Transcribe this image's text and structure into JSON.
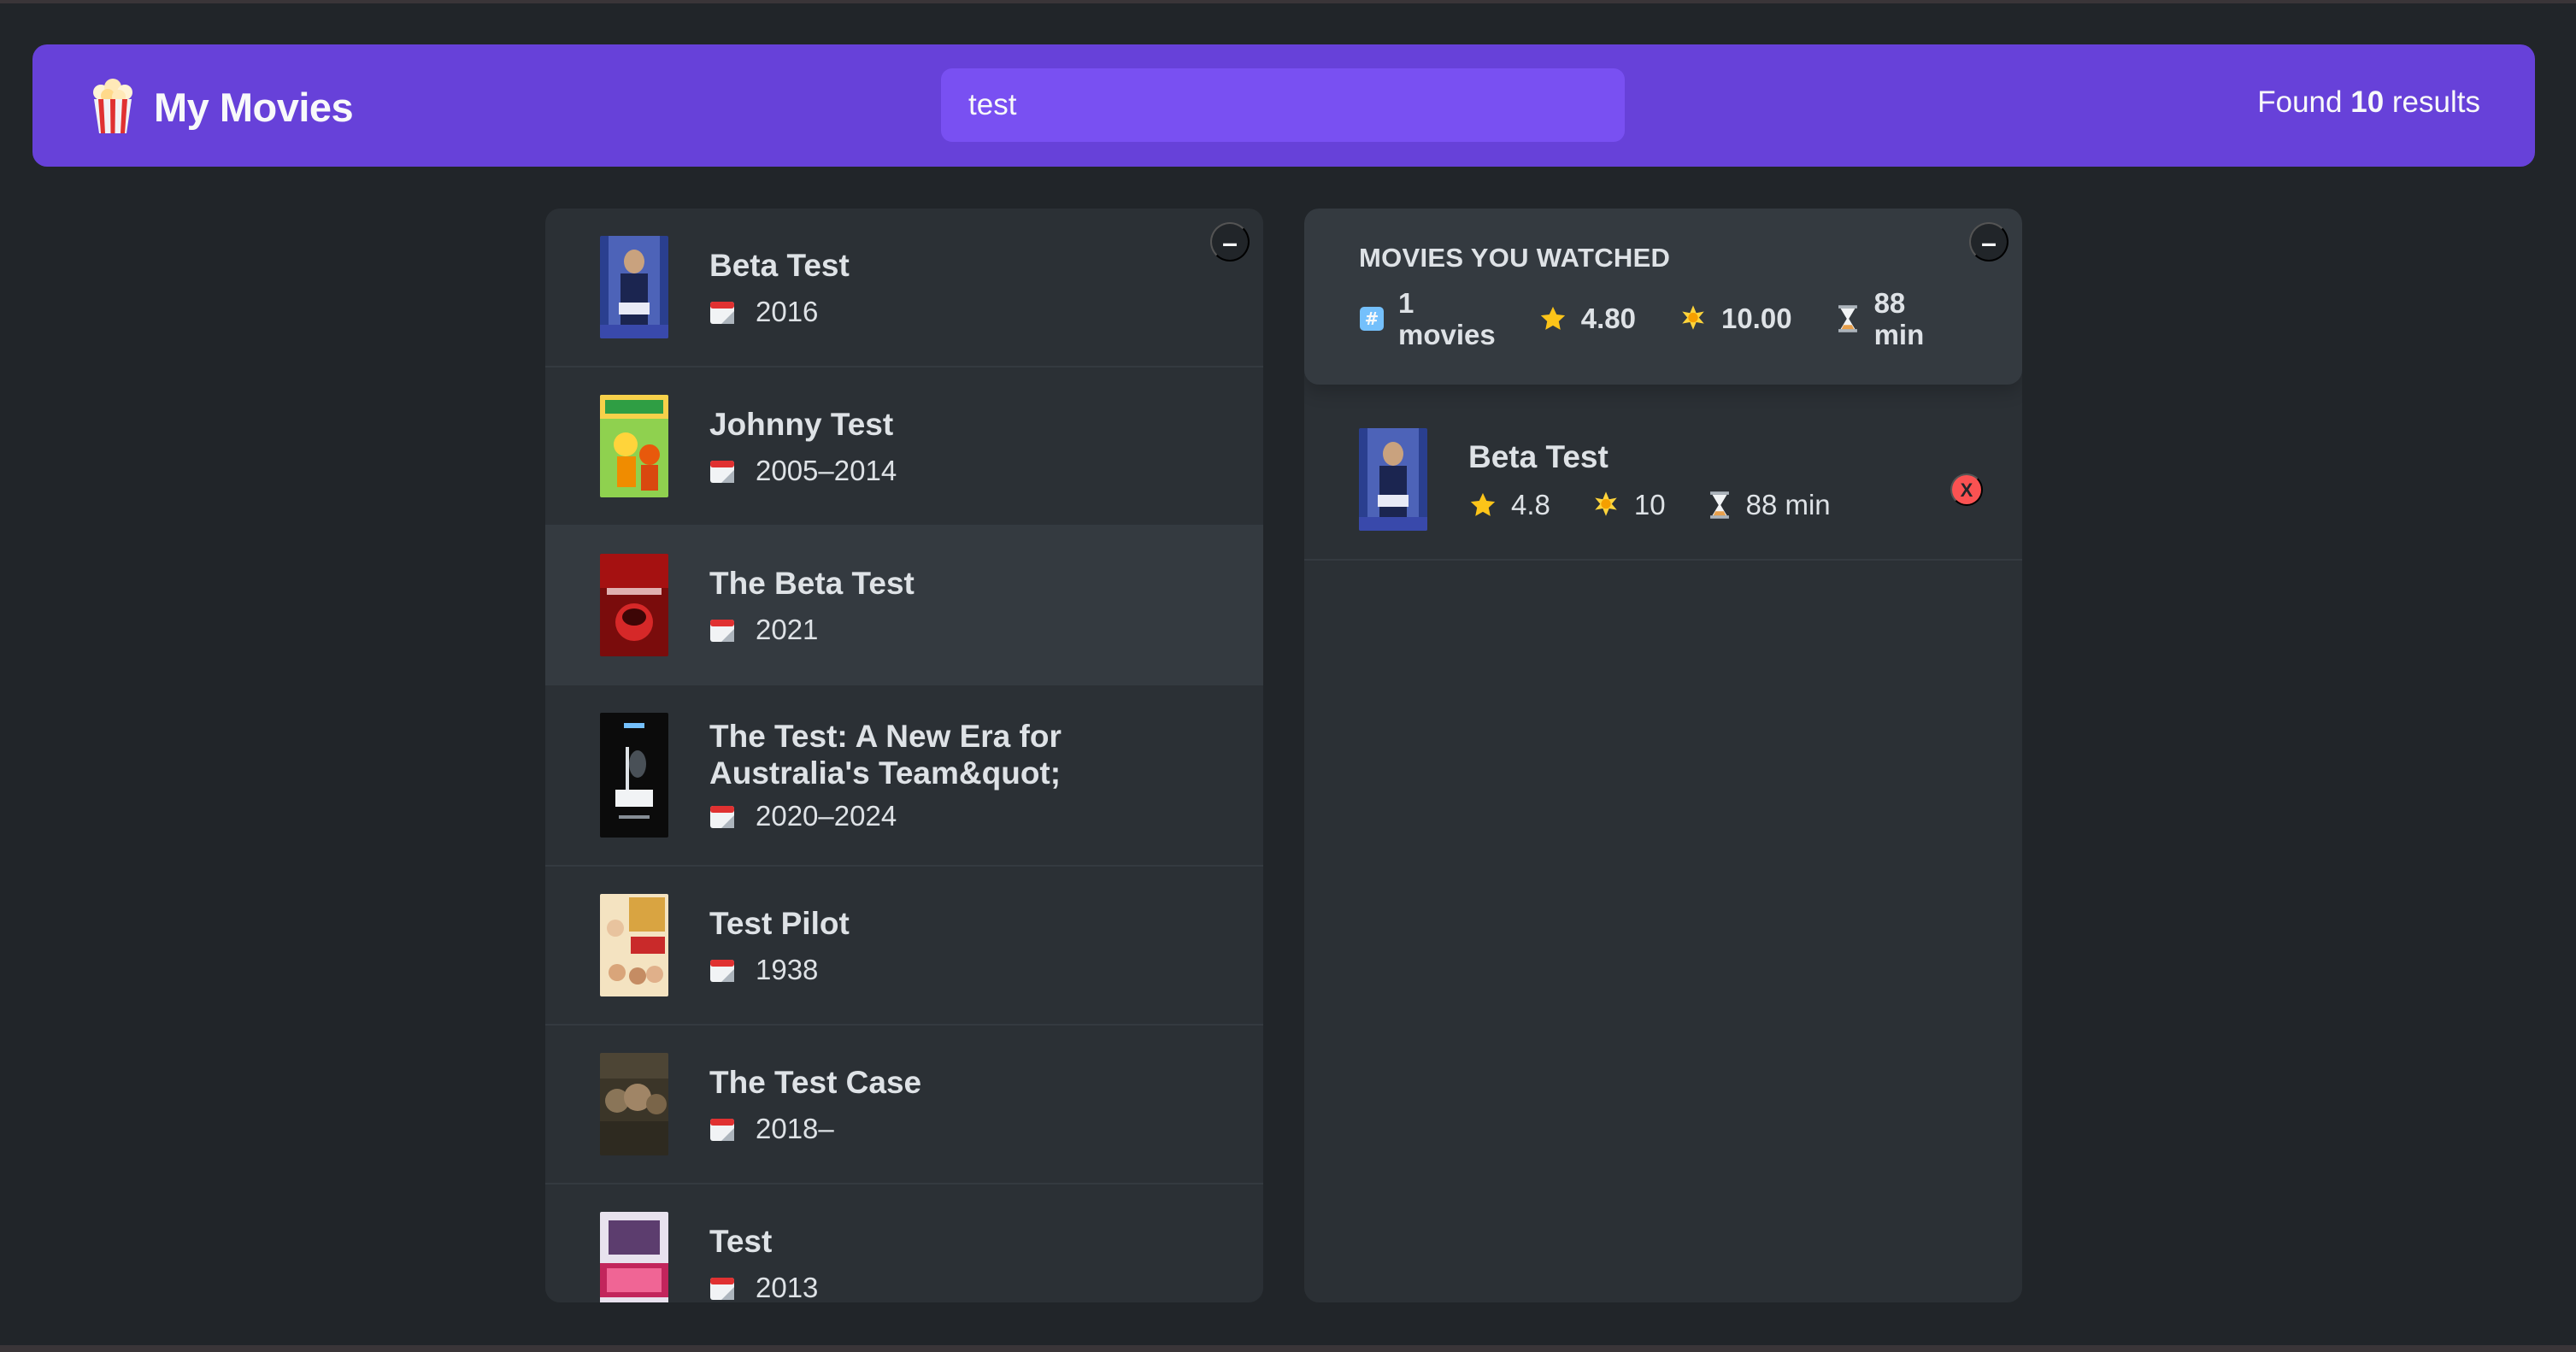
{
  "app": {
    "title": "My Movies",
    "logo_icon": "popcorn-icon"
  },
  "search": {
    "value": "test",
    "placeholder": "Search movies..."
  },
  "results": {
    "prefix": "Found",
    "count": "10",
    "suffix": "results"
  },
  "colors": {
    "accent": "#6741d9",
    "search_bg": "#7950f2",
    "background": "#212529",
    "box": "#2b3035",
    "delete": "#fa5252"
  },
  "list": {
    "toggle_label": "–",
    "movies": [
      {
        "title": "Beta Test",
        "year": "2016"
      },
      {
        "title": "Johnny Test",
        "year": "2005–2014"
      },
      {
        "title": "The Beta Test",
        "year": "2021"
      },
      {
        "title": "The Test: A New Era for Australia's Team&quot;",
        "year": "2020–2024"
      },
      {
        "title": "Test Pilot",
        "year": "1938"
      },
      {
        "title": "The Test Case",
        "year": "2018–"
      },
      {
        "title": "Test",
        "year": "2013"
      }
    ]
  },
  "summary": {
    "toggle_label": "–",
    "heading": "Movies you watched",
    "count_line1": "1",
    "count_line2": "movies",
    "imdb_avg": "4.80",
    "user_avg": "10.00",
    "runtime_line1": "88",
    "runtime_line2": "min"
  },
  "watched": [
    {
      "title": "Beta Test",
      "imdb": "4.8",
      "user": "10",
      "runtime": "88 min",
      "delete_label": "X"
    }
  ]
}
